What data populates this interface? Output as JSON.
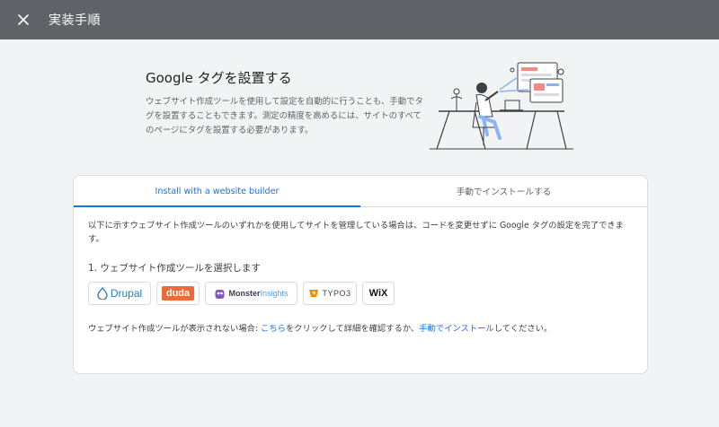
{
  "header": {
    "title": "実装手順"
  },
  "intro": {
    "title": "Google タグを設置する",
    "description": "ウェブサイト作成ツールを使用して設定を自動的に行うことも、手動でタグを設置することもできます。測定の精度を高めるには、サイトのすべてのページにタグを設置する必要があります。"
  },
  "tabs": [
    {
      "label": "Install with a website builder",
      "active": true
    },
    {
      "label": "手動でインストールする",
      "active": false
    }
  ],
  "builder": {
    "body": "以下に示すウェブサイト作成ツールのいずれかを使用してサイトを管理している場合は、コードを変更せずに Google タグの設定を完了できます。",
    "step_title": "1. ウェブサイト作成ツールを選択します",
    "logos": {
      "drupal": "Drupal",
      "duda": "duda",
      "monster_a": "Monster",
      "monster_b": "Insights",
      "typo3": "TYPO3",
      "wix": "WiX"
    },
    "footer": {
      "prefix": "ウェブサイト作成ツールが表示されない場合: ",
      "link1": "こちら",
      "middle": "をクリックして詳細を確認するか、",
      "link2": "手動でインストール",
      "suffix": "してください。"
    }
  },
  "colors": {
    "topbar": "#5f6368",
    "accent": "#1a73e8",
    "background": "#f1f3f4"
  },
  "icons": {
    "close": "close-icon",
    "illustration": "person-at-desk-illustration"
  }
}
